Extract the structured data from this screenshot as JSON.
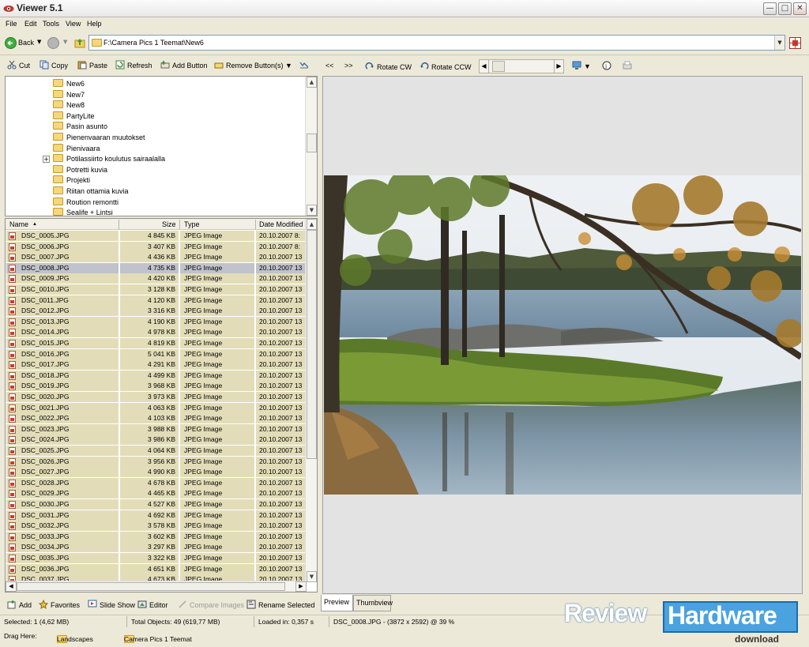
{
  "window": {
    "title": "Viewer 5.1",
    "min": "0",
    "max": "1",
    "close": "r"
  },
  "menu": [
    "File",
    "Edit",
    "Tools",
    "View",
    "Help"
  ],
  "address": {
    "back_label": "Back",
    "path": "F:\\Camera Pics 1 Teemat\\New6"
  },
  "toolbar_left": {
    "cut": "Cut",
    "copy": "Copy",
    "paste": "Paste",
    "refresh": "Refresh",
    "add_button": "Add Button",
    "remove_buttons": "Remove Button(s)"
  },
  "toolbar_right": {
    "prev": "<<",
    "next": ">>",
    "rotate_cw": "Rotate CW",
    "rotate_ccw": "Rotate CCW"
  },
  "tree": {
    "items": [
      "New6",
      "New7",
      "New8",
      "PartyLite",
      "Pasin asunto",
      "Pienenvaaran muutokset",
      "Pienivaara",
      "Potilassiirto koulutus sairaalalla",
      "Potretti kuvia",
      "Projekti",
      "Riitan ottamia kuvia",
      "Roution remontti",
      "Sealife + Lintsi"
    ],
    "expander": "+"
  },
  "file_list": {
    "columns": {
      "name": "Name",
      "size": "Size",
      "type": "Type",
      "modified": "Date Modified"
    },
    "selected_index": 3,
    "rows": [
      {
        "name": "DSC_0005.JPG",
        "size": "4 845 KB",
        "type": "JPEG Image",
        "date": "20.10.2007 8:"
      },
      {
        "name": "DSC_0006.JPG",
        "size": "3 407 KB",
        "type": "JPEG Image",
        "date": "20.10.2007 8:"
      },
      {
        "name": "DSC_0007.JPG",
        "size": "4 436 KB",
        "type": "JPEG Image",
        "date": "20.10.2007 13"
      },
      {
        "name": "DSC_0008.JPG",
        "size": "4 735 KB",
        "type": "JPEG Image",
        "date": "20.10.2007 13"
      },
      {
        "name": "DSC_0009.JPG",
        "size": "4 420 KB",
        "type": "JPEG Image",
        "date": "20.10.2007 13"
      },
      {
        "name": "DSC_0010.JPG",
        "size": "3 128 KB",
        "type": "JPEG Image",
        "date": "20.10.2007 13"
      },
      {
        "name": "DSC_0011.JPG",
        "size": "4 120 KB",
        "type": "JPEG Image",
        "date": "20.10.2007 13"
      },
      {
        "name": "DSC_0012.JPG",
        "size": "3 316 KB",
        "type": "JPEG Image",
        "date": "20.10.2007 13"
      },
      {
        "name": "DSC_0013.JPG",
        "size": "4 190 KB",
        "type": "JPEG Image",
        "date": "20.10.2007 13"
      },
      {
        "name": "DSC_0014.JPG",
        "size": "4 978 KB",
        "type": "JPEG Image",
        "date": "20.10.2007 13"
      },
      {
        "name": "DSC_0015.JPG",
        "size": "4 819 KB",
        "type": "JPEG Image",
        "date": "20.10.2007 13"
      },
      {
        "name": "DSC_0016.JPG",
        "size": "5 041 KB",
        "type": "JPEG Image",
        "date": "20.10.2007 13"
      },
      {
        "name": "DSC_0017.JPG",
        "size": "4 291 KB",
        "type": "JPEG Image",
        "date": "20.10.2007 13"
      },
      {
        "name": "DSC_0018.JPG",
        "size": "4 499 KB",
        "type": "JPEG Image",
        "date": "20.10.2007 13"
      },
      {
        "name": "DSC_0019.JPG",
        "size": "3 968 KB",
        "type": "JPEG Image",
        "date": "20.10.2007 13"
      },
      {
        "name": "DSC_0020.JPG",
        "size": "3 973 KB",
        "type": "JPEG Image",
        "date": "20.10.2007 13"
      },
      {
        "name": "DSC_0021.JPG",
        "size": "4 063 KB",
        "type": "JPEG Image",
        "date": "20.10.2007 13"
      },
      {
        "name": "DSC_0022.JPG",
        "size": "4 103 KB",
        "type": "JPEG Image",
        "date": "20.10.2007 13"
      },
      {
        "name": "DSC_0023.JPG",
        "size": "3 988 KB",
        "type": "JPEG Image",
        "date": "20.10.2007 13"
      },
      {
        "name": "DSC_0024.JPG",
        "size": "3 986 KB",
        "type": "JPEG Image",
        "date": "20.10.2007 13"
      },
      {
        "name": "DSC_0025.JPG",
        "size": "4 064 KB",
        "type": "JPEG Image",
        "date": "20.10.2007 13"
      },
      {
        "name": "DSC_0026.JPG",
        "size": "3 956 KB",
        "type": "JPEG Image",
        "date": "20.10.2007 13"
      },
      {
        "name": "DSC_0027.JPG",
        "size": "4 990 KB",
        "type": "JPEG Image",
        "date": "20.10.2007 13"
      },
      {
        "name": "DSC_0028.JPG",
        "size": "4 678 KB",
        "type": "JPEG Image",
        "date": "20.10.2007 13"
      },
      {
        "name": "DSC_0029.JPG",
        "size": "4 465 KB",
        "type": "JPEG Image",
        "date": "20.10.2007 13"
      },
      {
        "name": "DSC_0030.JPG",
        "size": "4 527 KB",
        "type": "JPEG Image",
        "date": "20.10.2007 13"
      },
      {
        "name": "DSC_0031.JPG",
        "size": "4 692 KB",
        "type": "JPEG Image",
        "date": "20.10.2007 13"
      },
      {
        "name": "DSC_0032.JPG",
        "size": "3 578 KB",
        "type": "JPEG Image",
        "date": "20.10.2007 13"
      },
      {
        "name": "DSC_0033.JPG",
        "size": "3 602 KB",
        "type": "JPEG Image",
        "date": "20.10.2007 13"
      },
      {
        "name": "DSC_0034.JPG",
        "size": "3 297 KB",
        "type": "JPEG Image",
        "date": "20.10.2007 13"
      },
      {
        "name": "DSC_0035.JPG",
        "size": "3 322 KB",
        "type": "JPEG Image",
        "date": "20.10.2007 13"
      },
      {
        "name": "DSC_0036.JPG",
        "size": "4 651 KB",
        "type": "JPEG Image",
        "date": "20.10.2007 13"
      },
      {
        "name": "DSC_0037.JPG",
        "size": "4 673 KB",
        "type": "JPEG Image",
        "date": "20.10.2007 13"
      }
    ]
  },
  "bottom_toolbar": {
    "add": "Add",
    "favorites": "Favorites",
    "slide_show": "Slide Show",
    "editor": "Editor",
    "compare": "Compare Images",
    "rename": "Rename Selected"
  },
  "preview_tabs": {
    "preview": "Preview",
    "thumbview": "Thumbview"
  },
  "status": {
    "selected": "Selected: 1 (4,62 MB)",
    "total": "Total Objects: 49 (619,77 MB)",
    "loaded": "Loaded in: 0,357 s",
    "info": "DSC_0008.JPG -  (3872 x 2592) @ 39  %"
  },
  "dragbar": {
    "label": "Drag Here:",
    "landscapes": "Landscapes",
    "camera": "Camera Pics 1 Teemat"
  },
  "watermark": {
    "review": "Review",
    "hardware": "Hardware",
    "download": "download"
  },
  "colors": {
    "row_bg": "#e2ddb8",
    "row_selected": "#c0c2cc",
    "window_bg": "#ece9d8",
    "preview_bg": "#e3e3e3",
    "watermark_blue": "#4aa2de"
  }
}
